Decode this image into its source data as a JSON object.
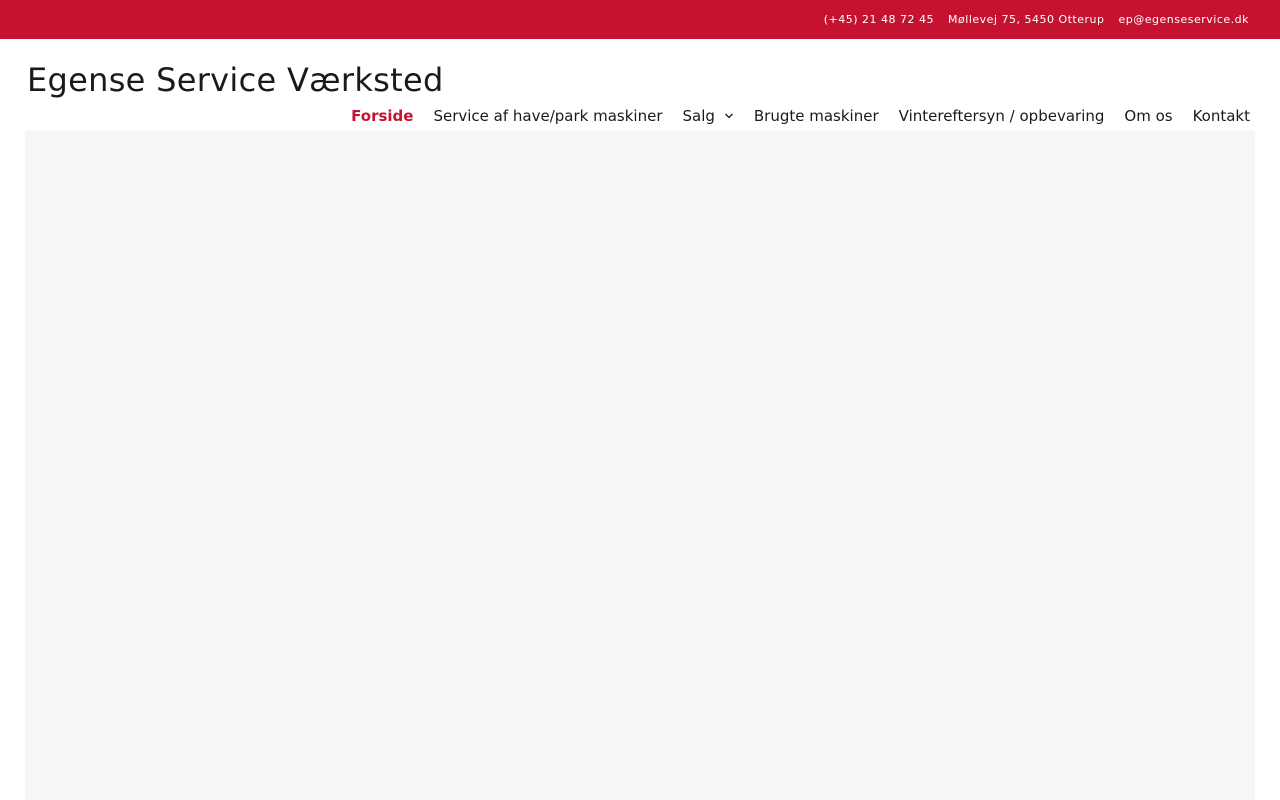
{
  "topbar": {
    "background_color": "#c41230",
    "phone": "(+45) 21 48 72 45",
    "address": "Møllevej 75, 5450 Otterup",
    "email": "ep@egenseservice.dk"
  },
  "header": {
    "site_title": "Egense Service Værksted"
  },
  "nav": {
    "accent_color": "#c41230",
    "items": [
      {
        "label": "Forside",
        "active": true
      },
      {
        "label": "Service af have/park maskiner"
      },
      {
        "label": "Salg",
        "has_dropdown": true,
        "icon": "chevron-down-icon"
      },
      {
        "label": "Brugte maskiner"
      },
      {
        "label": "Vintereftersyn / opbevaring"
      },
      {
        "label": "Om os"
      },
      {
        "label": "Kontakt"
      }
    ]
  },
  "hero": {
    "background_color": "#f6f6f6"
  }
}
